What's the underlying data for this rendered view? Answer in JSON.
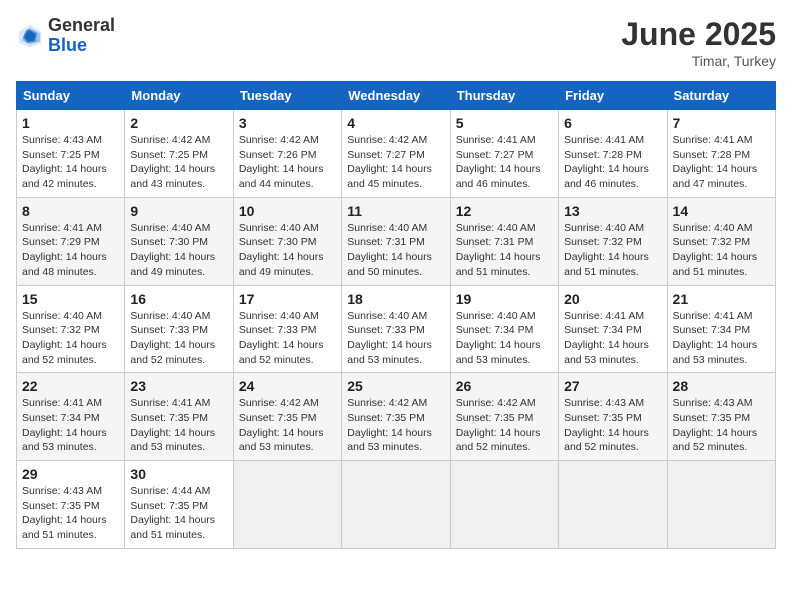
{
  "header": {
    "logo_general": "General",
    "logo_blue": "Blue",
    "month": "June 2025",
    "location": "Timar, Turkey"
  },
  "days_of_week": [
    "Sunday",
    "Monday",
    "Tuesday",
    "Wednesday",
    "Thursday",
    "Friday",
    "Saturday"
  ],
  "weeks": [
    [
      {
        "day": "1",
        "sunrise": "4:43 AM",
        "sunset": "7:25 PM",
        "daylight": "14 hours and 42 minutes."
      },
      {
        "day": "2",
        "sunrise": "4:42 AM",
        "sunset": "7:25 PM",
        "daylight": "14 hours and 43 minutes."
      },
      {
        "day": "3",
        "sunrise": "4:42 AM",
        "sunset": "7:26 PM",
        "daylight": "14 hours and 44 minutes."
      },
      {
        "day": "4",
        "sunrise": "4:42 AM",
        "sunset": "7:27 PM",
        "daylight": "14 hours and 45 minutes."
      },
      {
        "day": "5",
        "sunrise": "4:41 AM",
        "sunset": "7:27 PM",
        "daylight": "14 hours and 46 minutes."
      },
      {
        "day": "6",
        "sunrise": "4:41 AM",
        "sunset": "7:28 PM",
        "daylight": "14 hours and 46 minutes."
      },
      {
        "day": "7",
        "sunrise": "4:41 AM",
        "sunset": "7:28 PM",
        "daylight": "14 hours and 47 minutes."
      }
    ],
    [
      {
        "day": "8",
        "sunrise": "4:41 AM",
        "sunset": "7:29 PM",
        "daylight": "14 hours and 48 minutes."
      },
      {
        "day": "9",
        "sunrise": "4:40 AM",
        "sunset": "7:30 PM",
        "daylight": "14 hours and 49 minutes."
      },
      {
        "day": "10",
        "sunrise": "4:40 AM",
        "sunset": "7:30 PM",
        "daylight": "14 hours and 49 minutes."
      },
      {
        "day": "11",
        "sunrise": "4:40 AM",
        "sunset": "7:31 PM",
        "daylight": "14 hours and 50 minutes."
      },
      {
        "day": "12",
        "sunrise": "4:40 AM",
        "sunset": "7:31 PM",
        "daylight": "14 hours and 51 minutes."
      },
      {
        "day": "13",
        "sunrise": "4:40 AM",
        "sunset": "7:32 PM",
        "daylight": "14 hours and 51 minutes."
      },
      {
        "day": "14",
        "sunrise": "4:40 AM",
        "sunset": "7:32 PM",
        "daylight": "14 hours and 51 minutes."
      }
    ],
    [
      {
        "day": "15",
        "sunrise": "4:40 AM",
        "sunset": "7:32 PM",
        "daylight": "14 hours and 52 minutes."
      },
      {
        "day": "16",
        "sunrise": "4:40 AM",
        "sunset": "7:33 PM",
        "daylight": "14 hours and 52 minutes."
      },
      {
        "day": "17",
        "sunrise": "4:40 AM",
        "sunset": "7:33 PM",
        "daylight": "14 hours and 52 minutes."
      },
      {
        "day": "18",
        "sunrise": "4:40 AM",
        "sunset": "7:33 PM",
        "daylight": "14 hours and 53 minutes."
      },
      {
        "day": "19",
        "sunrise": "4:40 AM",
        "sunset": "7:34 PM",
        "daylight": "14 hours and 53 minutes."
      },
      {
        "day": "20",
        "sunrise": "4:41 AM",
        "sunset": "7:34 PM",
        "daylight": "14 hours and 53 minutes."
      },
      {
        "day": "21",
        "sunrise": "4:41 AM",
        "sunset": "7:34 PM",
        "daylight": "14 hours and 53 minutes."
      }
    ],
    [
      {
        "day": "22",
        "sunrise": "4:41 AM",
        "sunset": "7:34 PM",
        "daylight": "14 hours and 53 minutes."
      },
      {
        "day": "23",
        "sunrise": "4:41 AM",
        "sunset": "7:35 PM",
        "daylight": "14 hours and 53 minutes."
      },
      {
        "day": "24",
        "sunrise": "4:42 AM",
        "sunset": "7:35 PM",
        "daylight": "14 hours and 53 minutes."
      },
      {
        "day": "25",
        "sunrise": "4:42 AM",
        "sunset": "7:35 PM",
        "daylight": "14 hours and 53 minutes."
      },
      {
        "day": "26",
        "sunrise": "4:42 AM",
        "sunset": "7:35 PM",
        "daylight": "14 hours and 52 minutes."
      },
      {
        "day": "27",
        "sunrise": "4:43 AM",
        "sunset": "7:35 PM",
        "daylight": "14 hours and 52 minutes."
      },
      {
        "day": "28",
        "sunrise": "4:43 AM",
        "sunset": "7:35 PM",
        "daylight": "14 hours and 52 minutes."
      }
    ],
    [
      {
        "day": "29",
        "sunrise": "4:43 AM",
        "sunset": "7:35 PM",
        "daylight": "14 hours and 51 minutes."
      },
      {
        "day": "30",
        "sunrise": "4:44 AM",
        "sunset": "7:35 PM",
        "daylight": "14 hours and 51 minutes."
      },
      null,
      null,
      null,
      null,
      null
    ]
  ]
}
